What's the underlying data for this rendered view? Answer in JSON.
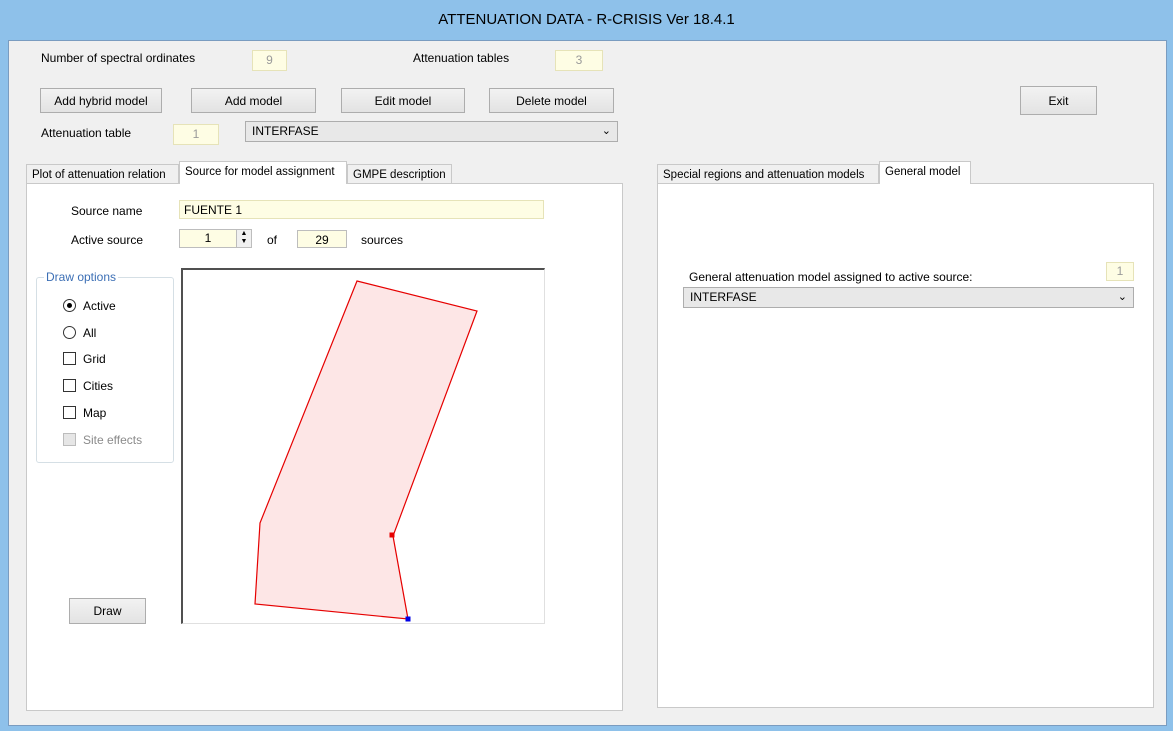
{
  "window": {
    "title": "ATTENUATION DATA - R-CRISIS Ver 18.4.1"
  },
  "header": {
    "spectral_label": "Number of spectral ordinates",
    "spectral_value": "9",
    "tables_label": "Attenuation tables",
    "tables_value": "3",
    "attenuation_table_label": "Attenuation table",
    "attenuation_table_value": "1",
    "model_select_value": "INTERFASE"
  },
  "buttons": {
    "add_hybrid": "Add hybrid model",
    "add_model": "Add model",
    "edit_model": "Edit model",
    "delete_model": "Delete model",
    "exit": "Exit",
    "draw": "Draw"
  },
  "left_tabs": [
    "Plot of attenuation relation",
    "Source for model assignment",
    "GMPE description"
  ],
  "source": {
    "name_label": "Source name",
    "name_value": "FUENTE 1",
    "active_label": "Active source",
    "active_value": "1",
    "of_label": "of",
    "total_value": "29",
    "sources_label": "sources"
  },
  "draw_options": {
    "legend": "Draw options",
    "active": "Active",
    "all": "All",
    "grid": "Grid",
    "cities": "Cities",
    "map": "Map",
    "site_effects": "Site effects"
  },
  "right_tabs": [
    "Special regions and attenuation models",
    "General model"
  ],
  "general_model": {
    "label": "General attenuation model assigned to active source:",
    "index_value": "1",
    "select_value": "INTERFASE"
  },
  "colors": {
    "polygon_fill": "#fde6e6",
    "polygon_stroke": "#e60000",
    "marker_red": "#e60000",
    "marker_blue": "#0000e6"
  }
}
